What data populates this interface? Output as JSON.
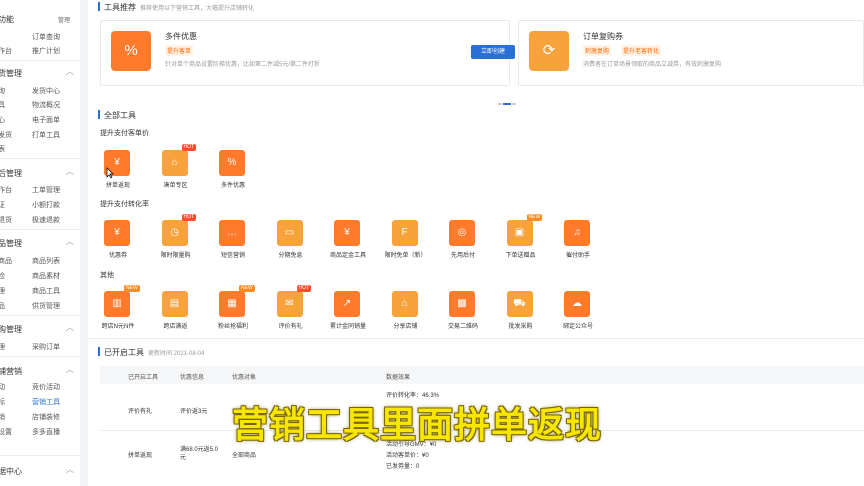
{
  "sidebar": {
    "top_title": "功能",
    "top_badge": "管理",
    "top_items": [
      "订单查询",
      "作台",
      "推广计划"
    ],
    "groups": [
      {
        "title": "货管理",
        "items": [
          "询",
          "发货中心",
          "具",
          "物流概况",
          "心",
          "电子面单",
          "发货",
          "打单工具",
          "表"
        ]
      },
      {
        "title": "后管理",
        "items": [
          "作台",
          "工单管理",
          "证",
          "小额打款",
          "退货",
          "极速退款"
        ]
      },
      {
        "title": "品管理",
        "items": [
          "商品",
          "商品列表",
          "检",
          "商品素材",
          "理",
          "商品工具",
          "品",
          "供货管理"
        ]
      },
      {
        "title": "购管理",
        "items": [
          "理",
          "采购订单"
        ]
      },
      {
        "title": "铺营销",
        "items": [
          "动",
          "竞价活动",
          "标",
          "营销工具",
          "销",
          "店铺装修",
          "设置",
          "多多直播"
        ]
      },
      {
        "title": "据中心",
        "items": []
      }
    ]
  },
  "recommend": {
    "title": "工具推荐",
    "subtitle": "推荐使用以下营销工具，大幅提升店铺转化",
    "cards": [
      {
        "title": "多件优惠",
        "tag": "提升客单",
        "desc": "针对单个商品设置阶梯优惠，比如第二件减5元/第二件打折",
        "button": "立即创建",
        "icon": "percent-icon"
      },
      {
        "title": "订单复购券",
        "tags": [
          "刺激复购",
          "提升老客转化"
        ],
        "desc": "消费者在订单场景领取的商品立减券，有效刺激复购",
        "icon": "refresh-coupon-icon"
      }
    ]
  },
  "all_tools": {
    "title": "全部工具",
    "categories": [
      {
        "label": "提升支付客单价",
        "tools": [
          {
            "label": "拼单返现",
            "badge": "",
            "glyph": "¥"
          },
          {
            "label": "凑单专区",
            "badge": "HOT",
            "glyph": "⌂"
          },
          {
            "label": "多件优惠",
            "badge": "",
            "glyph": "%"
          }
        ]
      },
      {
        "label": "提升支付转化率",
        "tools": [
          {
            "label": "优惠券",
            "badge": "",
            "glyph": "¥"
          },
          {
            "label": "限时限量购",
            "badge": "HOT",
            "glyph": "◷"
          },
          {
            "label": "短信营销",
            "badge": "",
            "glyph": "…"
          },
          {
            "label": "分期免息",
            "badge": "",
            "glyph": "▭"
          },
          {
            "label": "商品定金工具",
            "badge": "",
            "glyph": "¥"
          },
          {
            "label": "限时免单（新）",
            "badge": "",
            "glyph": "F"
          },
          {
            "label": "先用后付",
            "badge": "",
            "glyph": "◎"
          },
          {
            "label": "下单送赠品",
            "badge": "NEW",
            "glyph": "▣"
          },
          {
            "label": "催付助手",
            "badge": "",
            "glyph": "♫"
          }
        ]
      },
      {
        "label": "其他",
        "tools": [
          {
            "label": "跨店N元N件",
            "badge": "NEW",
            "glyph": "▥"
          },
          {
            "label": "跨店满返",
            "badge": "",
            "glyph": "▤"
          },
          {
            "label": "粉丝抢福利",
            "badge": "NEW",
            "glyph": "▦"
          },
          {
            "label": "评价有礼",
            "badge": "HOT",
            "glyph": "✉"
          },
          {
            "label": "累计金同销量",
            "badge": "",
            "glyph": "↗"
          },
          {
            "label": "分享店铺",
            "badge": "",
            "glyph": "⌂"
          },
          {
            "label": "交易二维码",
            "badge": "",
            "glyph": "▩"
          },
          {
            "label": "批发采购",
            "badge": "",
            "glyph": "⛟"
          },
          {
            "label": "绑定公众号",
            "badge": "",
            "glyph": "☁"
          }
        ]
      }
    ]
  },
  "opened": {
    "title": "已开启工具",
    "updated": "更新时间 2021-08-04",
    "headers": [
      "已开启工具",
      "优惠信息",
      "优惠对象",
      "数据效果"
    ],
    "rows": [
      {
        "tool": "评价有礼",
        "info": "评价返3元",
        "target": "",
        "effects": [
          "评价转化率：46.3%",
          "",
          ""
        ]
      },
      {
        "tool": "拼单返现",
        "info": "满68.0元返5.0元",
        "target": "全部商品",
        "effects": [
          "活动引导GMV：¥0",
          "活动客单价：¥0",
          "已发券量：0"
        ]
      }
    ]
  },
  "caption": "营销工具里面拼单返现",
  "colors": {
    "accent": "#2a6fd6",
    "orange": "#ff7a2b",
    "caption": "#f7e600"
  }
}
